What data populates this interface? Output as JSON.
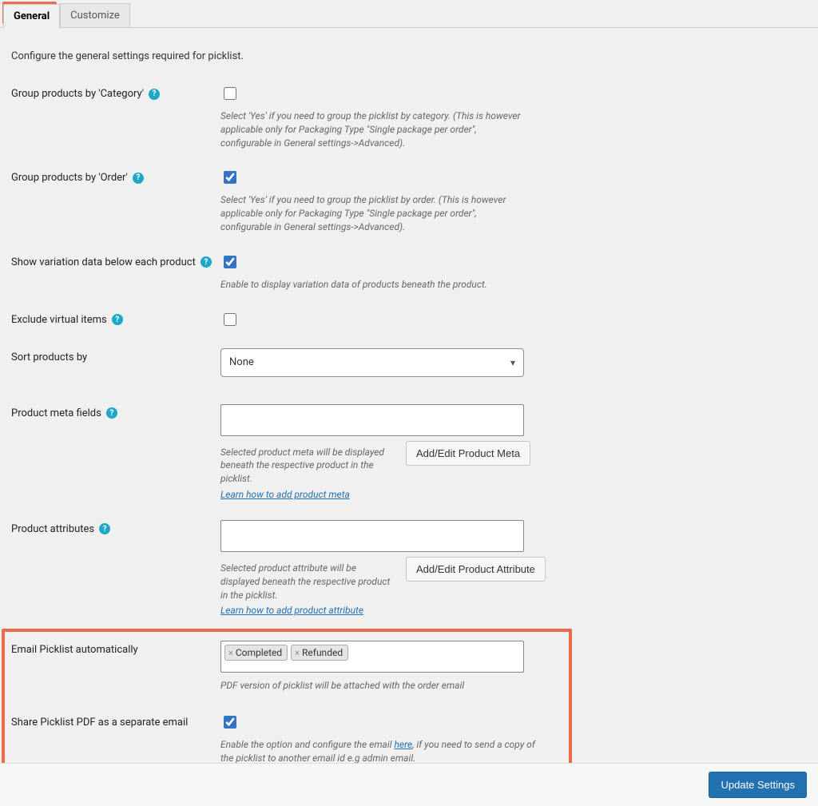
{
  "tabs": [
    {
      "label": "General",
      "active": true
    },
    {
      "label": "Customize",
      "active": false
    }
  ],
  "intro": "Configure the general settings required for picklist.",
  "settings": {
    "group_by_category": {
      "label": "Group products by 'Category'",
      "checked": false,
      "desc": "Select 'Yes' if you need to group the picklist by category. (This is however applicable only for Packaging Type \"Single package per order\", configurable in General settings->Advanced)."
    },
    "group_by_order": {
      "label": "Group products by 'Order'",
      "checked": true,
      "desc": "Select 'Yes' if you need to group the picklist by order. (This is however applicable only for Packaging Type \"Single package per order\", configurable in General settings->Advanced)."
    },
    "show_variation": {
      "label": "Show variation data below each product",
      "checked": true,
      "desc": "Enable to display variation data of products beneath the product."
    },
    "exclude_virtual": {
      "label": "Exclude virtual items",
      "checked": false
    },
    "sort_by": {
      "label": "Sort products by",
      "value": "None"
    },
    "product_meta": {
      "label": "Product meta fields",
      "button": "Add/Edit Product Meta",
      "desc": "Selected product meta will be displayed beneath the respective product in the picklist.",
      "link": "Learn how to add product meta"
    },
    "product_attributes": {
      "label": "Product attributes",
      "button": "Add/Edit Product Attribute",
      "desc": "Selected product attribute will be displayed beneath the respective product in the picklist.",
      "link": "Learn how to add product attribute"
    },
    "email_auto": {
      "label": "Email Picklist automatically",
      "tags": [
        "Completed",
        "Refunded"
      ],
      "desc": "PDF version of picklist will be attached with the order email"
    },
    "share_separate": {
      "label": "Share Picklist PDF as a separate email",
      "checked": true,
      "desc_pre": "Enable the option and configure the email ",
      "desc_link": "here ",
      "desc_post": ", if you need to send a copy of the picklist to another email id e.g admin email."
    }
  },
  "footer": {
    "save_label": "Update Settings"
  }
}
